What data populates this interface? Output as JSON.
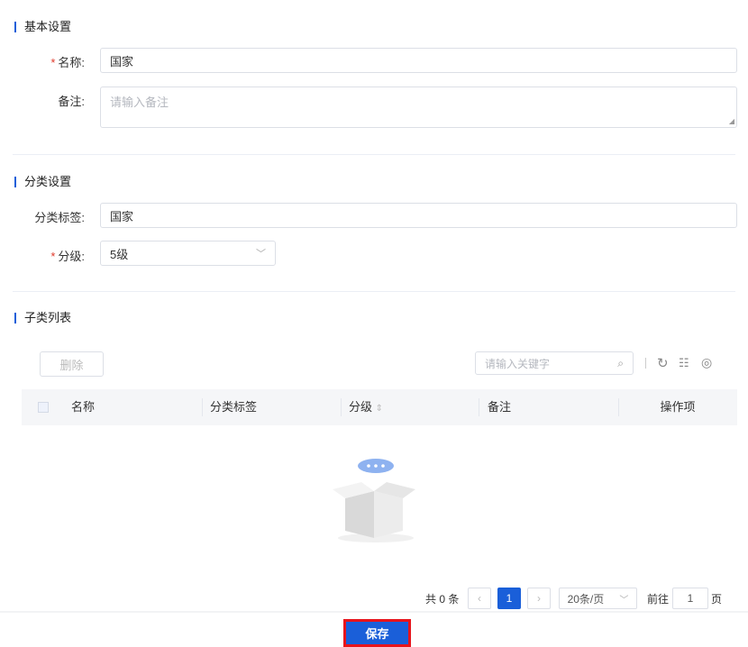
{
  "basic": {
    "title": "基本设置",
    "name_label": "名称:",
    "name_value": "国家",
    "remark_label": "备注:",
    "remark_placeholder": "请输入备注"
  },
  "category": {
    "title": "分类设置",
    "tag_label": "分类标签:",
    "tag_value": "国家",
    "level_label": "分级:",
    "level_value": "5级"
  },
  "sublist": {
    "title": "子类列表",
    "delete_label": "删除",
    "search_placeholder": "请输入关键字",
    "columns": [
      "名称",
      "分类标签",
      "分级",
      "备注",
      "操作项"
    ]
  },
  "pagination": {
    "total": "共 0 条",
    "current_page": "1",
    "page_size": "20条/页",
    "goto_label": "前往",
    "goto_value": "1",
    "page_suffix": "页"
  },
  "footer": {
    "save_label": "保存"
  },
  "colors": {
    "accent": "#1a5fd9",
    "required": "#e0392b",
    "highlight": "#e8141b"
  }
}
